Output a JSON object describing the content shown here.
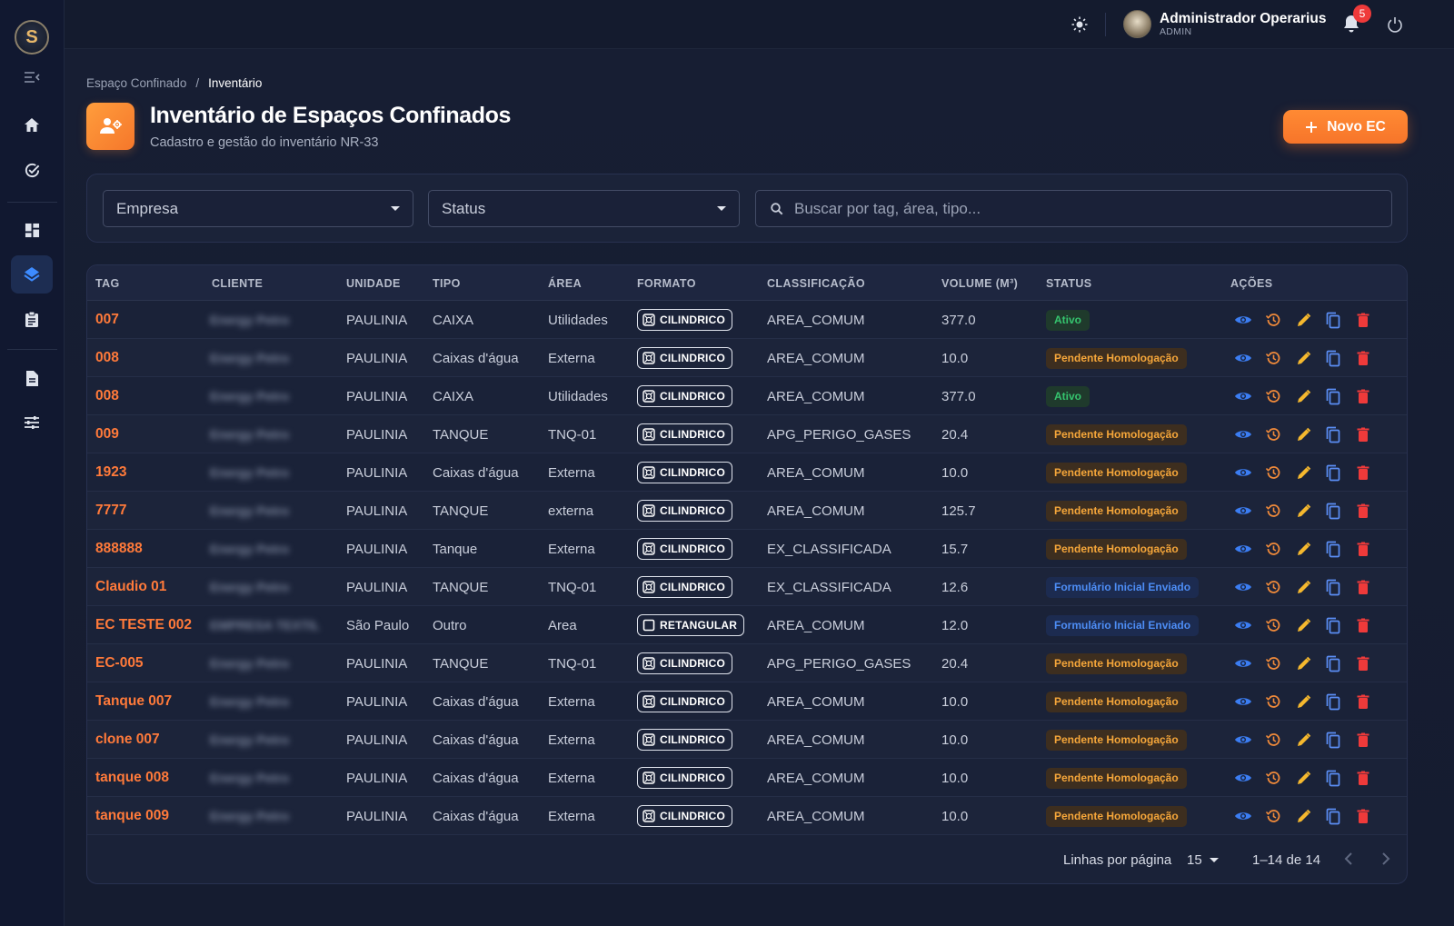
{
  "app": {
    "logo_letter": "S",
    "user_name": "Administrador Operarius",
    "user_role": "ADMIN",
    "notification_count": "5"
  },
  "breadcrumb": {
    "parent": "Espaço Confinado",
    "separator": "/",
    "current": "Inventário"
  },
  "page": {
    "title": "Inventário de Espaços Confinados",
    "subtitle": "Cadastro e gestão do inventário NR-33",
    "new_button": "Novo EC"
  },
  "filters": {
    "empresa": "Empresa",
    "status": "Status",
    "search_placeholder": "Buscar por tag, área, tipo..."
  },
  "table": {
    "columns": [
      "TAG",
      "CLIENTE",
      "UNIDADE",
      "TIPO",
      "ÁREA",
      "FORMATO",
      "CLASSIFICAÇÃO",
      "VOLUME (M³)",
      "STATUS",
      "AÇÕES"
    ],
    "rows": [
      {
        "tag": "007",
        "cliente": "Energy Petro",
        "unidade": "PAULINIA",
        "tipo": "CAIXA",
        "area": "Utilidades",
        "formato": "CILINDRICO",
        "classificacao": "AREA_COMUM",
        "volume": "377.0",
        "status": "Ativo",
        "status_kind": "ativo"
      },
      {
        "tag": "008",
        "cliente": "Energy Petro",
        "unidade": "PAULINIA",
        "tipo": "Caixas d'água",
        "area": "Externa",
        "formato": "CILINDRICO",
        "classificacao": "AREA_COMUM",
        "volume": "10.0",
        "status": "Pendente Homologação",
        "status_kind": "pend"
      },
      {
        "tag": "008",
        "cliente": "Energy Petro",
        "unidade": "PAULINIA",
        "tipo": "CAIXA",
        "area": "Utilidades",
        "formato": "CILINDRICO",
        "classificacao": "AREA_COMUM",
        "volume": "377.0",
        "status": "Ativo",
        "status_kind": "ativo"
      },
      {
        "tag": "009",
        "cliente": "Energy Petro",
        "unidade": "PAULINIA",
        "tipo": "TANQUE",
        "area": "TNQ-01",
        "formato": "CILINDRICO",
        "classificacao": "APG_PERIGO_GASES",
        "volume": "20.4",
        "status": "Pendente Homologação",
        "status_kind": "pend"
      },
      {
        "tag": "1923",
        "cliente": "Energy Petro",
        "unidade": "PAULINIA",
        "tipo": "Caixas d'água",
        "area": "Externa",
        "formato": "CILINDRICO",
        "classificacao": "AREA_COMUM",
        "volume": "10.0",
        "status": "Pendente Homologação",
        "status_kind": "pend"
      },
      {
        "tag": "7777",
        "cliente": "Energy Petro",
        "unidade": "PAULINIA",
        "tipo": "TANQUE",
        "area": "externa",
        "formato": "CILINDRICO",
        "classificacao": "AREA_COMUM",
        "volume": "125.7",
        "status": "Pendente Homologação",
        "status_kind": "pend"
      },
      {
        "tag": "888888",
        "cliente": "Energy Petro",
        "unidade": "PAULINIA",
        "tipo": "Tanque",
        "area": "Externa",
        "formato": "CILINDRICO",
        "classificacao": "EX_CLASSIFICADA",
        "volume": "15.7",
        "status": "Pendente Homologação",
        "status_kind": "pend"
      },
      {
        "tag": "Claudio 01",
        "cliente": "Energy Petro",
        "unidade": "PAULINIA",
        "tipo": "TANQUE",
        "area": "TNQ-01",
        "formato": "CILINDRICO",
        "classificacao": "EX_CLASSIFICADA",
        "volume": "12.6",
        "status": "Formulário Inicial Enviado",
        "status_kind": "form"
      },
      {
        "tag": "EC TESTE 002",
        "cliente": "EMPRESA TEXTIL",
        "unidade": "São Paulo",
        "tipo": "Outro",
        "area": "Area",
        "formato": "RETANGULAR",
        "classificacao": "AREA_COMUM",
        "volume": "12.0",
        "status": "Formulário Inicial Enviado",
        "status_kind": "form"
      },
      {
        "tag": "EC-005",
        "cliente": "Energy Petro",
        "unidade": "PAULINIA",
        "tipo": "TANQUE",
        "area": "TNQ-01",
        "formato": "CILINDRICO",
        "classificacao": "APG_PERIGO_GASES",
        "volume": "20.4",
        "status": "Pendente Homologação",
        "status_kind": "pend"
      },
      {
        "tag": "Tanque 007",
        "cliente": "Energy Petro",
        "unidade": "PAULINIA",
        "tipo": "Caixas d'água",
        "area": "Externa",
        "formato": "CILINDRICO",
        "classificacao": "AREA_COMUM",
        "volume": "10.0",
        "status": "Pendente Homologação",
        "status_kind": "pend"
      },
      {
        "tag": "clone 007",
        "cliente": "Energy Petro",
        "unidade": "PAULINIA",
        "tipo": "Caixas d'água",
        "area": "Externa",
        "formato": "CILINDRICO",
        "classificacao": "AREA_COMUM",
        "volume": "10.0",
        "status": "Pendente Homologação",
        "status_kind": "pend"
      },
      {
        "tag": "tanque 008",
        "cliente": "Energy Petro",
        "unidade": "PAULINIA",
        "tipo": "Caixas d'água",
        "area": "Externa",
        "formato": "CILINDRICO",
        "classificacao": "AREA_COMUM",
        "volume": "10.0",
        "status": "Pendente Homologação",
        "status_kind": "pend"
      },
      {
        "tag": "tanque 009",
        "cliente": "Energy Petro",
        "unidade": "PAULINIA",
        "tipo": "Caixas d'água",
        "area": "Externa",
        "formato": "CILINDRICO",
        "classificacao": "AREA_COMUM",
        "volume": "10.0",
        "status": "Pendente Homologação",
        "status_kind": "pend"
      }
    ]
  },
  "pagination": {
    "rows_per_page_label": "Linhas por página",
    "rows_per_page": "15",
    "range": "1–14 de 14"
  },
  "colors": {
    "accent": "#ff7a3a",
    "ativo": "#35c46e",
    "pendente": "#f5a63a",
    "formulario": "#4d8df5",
    "view_icon": "#3b7df2",
    "history_icon": "#f08a3a",
    "edit_icon": "#f5b82e",
    "copy_icon": "#5b8ef5",
    "delete_icon": "#ef3a3a"
  }
}
